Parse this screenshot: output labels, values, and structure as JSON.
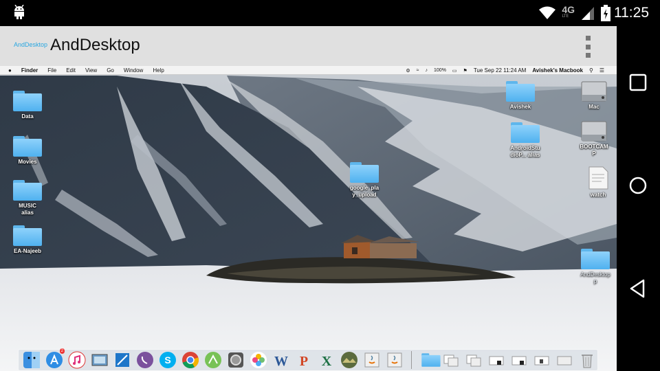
{
  "status_bar": {
    "network_label": "4G",
    "network_sub": "LTE",
    "time": "11:25"
  },
  "app_bar": {
    "logo_text": "AndDesktop",
    "title": "AndDesktop"
  },
  "mac_menubar": {
    "apple": "",
    "items": [
      "Finder",
      "File",
      "Edit",
      "View",
      "Go",
      "Window",
      "Help"
    ],
    "battery": "100%",
    "date_time": "Tue Sep 22  11:24 AM",
    "user": "Avishek's Macbook"
  },
  "desktop_icons": {
    "data": "Data",
    "movies": "Movies",
    "music": "MUSIC\nalias",
    "ea": "EA-Najeeb",
    "google": "google_pla\ny_upload",
    "avishek": "Avishek",
    "androidstudio": "AndroidStu\ndioP... alias",
    "mac": "Mac",
    "bootcamp": "BOOTCAM\nP",
    "watch": "watch",
    "anddesktop": "AndDesktop\np"
  },
  "dock": {
    "appstore_badge": "2"
  },
  "colors": {
    "folder_blue": "#5eb6ec",
    "app_bar": "#e0e0e0",
    "logo": "#29a7e1"
  }
}
